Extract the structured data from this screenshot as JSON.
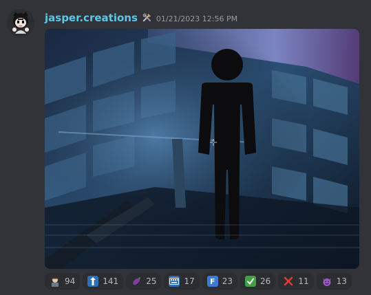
{
  "message": {
    "username": "jasper.creations",
    "role_icon": "tools-icon",
    "timestamp": "01/21/2023 12:56 PM"
  },
  "attachment": {
    "subject": "restroom-sign-figure-icon"
  },
  "reactions": [
    {
      "icon": "cartoon-face-emoji",
      "count": "94"
    },
    {
      "icon": "up-arrow-person-emoji",
      "count": "141"
    },
    {
      "icon": "eggplant-emoji",
      "count": "25"
    },
    {
      "icon": "keyboard-emoji",
      "count": "17"
    },
    {
      "icon": "letter-f-emoji",
      "count": "23"
    },
    {
      "icon": "check-mark-emoji",
      "count": "26"
    },
    {
      "icon": "cross-mark-emoji",
      "count": "11"
    },
    {
      "icon": "smiling-devil-emoji",
      "count": "13"
    }
  ]
}
